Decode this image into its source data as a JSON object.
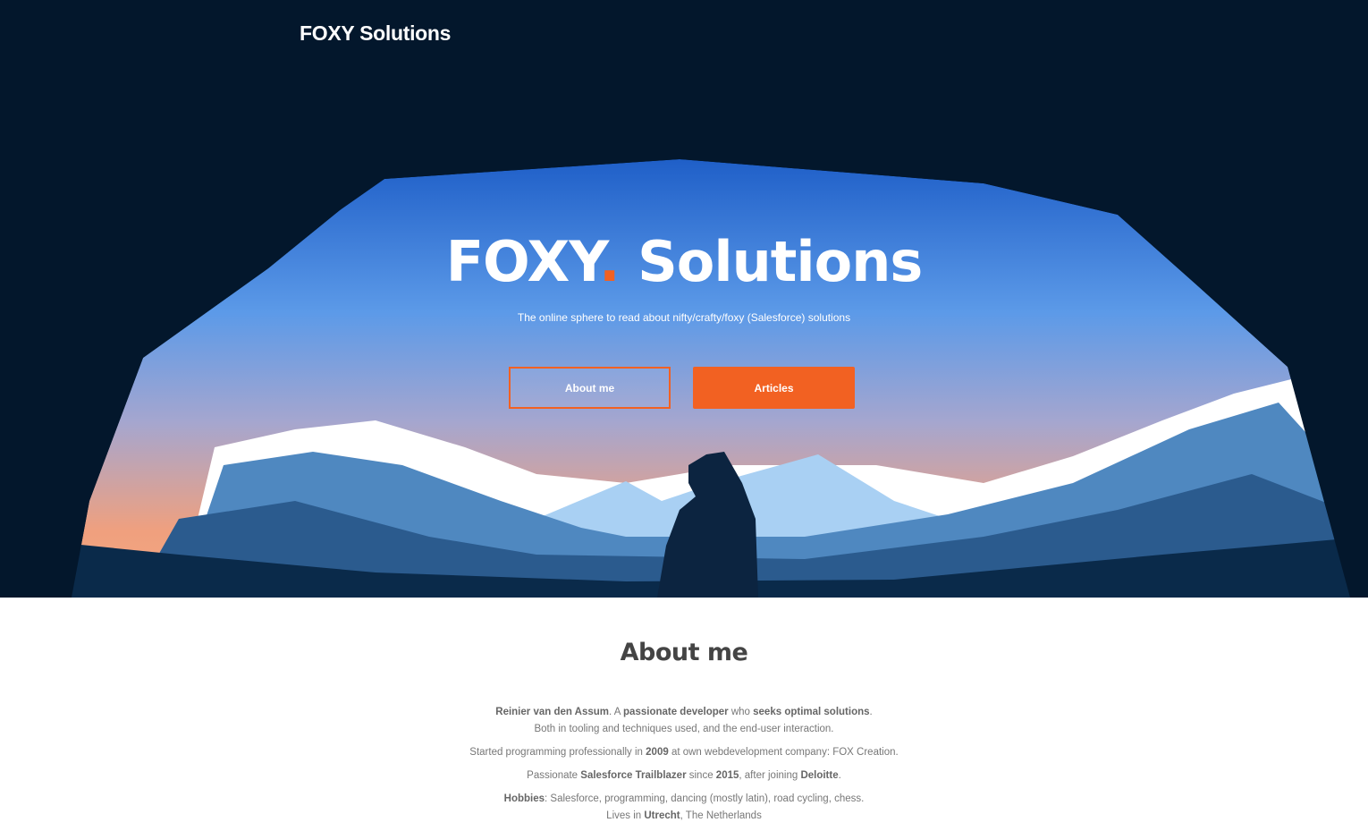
{
  "header": {
    "brand": "FOXY Solutions"
  },
  "hero": {
    "title_part1": "FOXY",
    "title_dot": ".",
    "title_part2": " Solutions",
    "tagline": "The online sphere to read about nifty/crafty/foxy (Salesforce) solutions",
    "buttons": {
      "about": "About me",
      "articles": "Articles"
    }
  },
  "about": {
    "heading": "About me",
    "paragraphs": [
      [
        [
          {
            "t": "Reinier van den Assum",
            "b": true
          },
          {
            "t": ". A "
          },
          {
            "t": "passionate developer",
            "b": true
          },
          {
            "t": " who "
          },
          {
            "t": "seeks optimal solutions",
            "b": true
          },
          {
            "t": "."
          }
        ],
        [
          {
            "t": "Both in tooling and techniques used, and the end-user interaction."
          }
        ]
      ],
      [
        [
          {
            "t": "Started programming professionally in "
          },
          {
            "t": "2009",
            "b": true
          },
          {
            "t": " at own webdevelopment company: FOX Creation."
          }
        ]
      ],
      [
        [
          {
            "t": "Passionate "
          },
          {
            "t": "Salesforce Trailblazer",
            "b": true
          },
          {
            "t": " since "
          },
          {
            "t": "2015",
            "b": true
          },
          {
            "t": ", after joining "
          },
          {
            "t": "Deloitte",
            "b": true
          },
          {
            "t": "."
          }
        ]
      ],
      [
        [
          {
            "t": "Hobbies",
            "b": true
          },
          {
            "t": ": Salesforce, programming, dancing (mostly latin), road cycling, chess."
          }
        ],
        [
          {
            "t": "Lives in "
          },
          {
            "t": "Utrecht",
            "b": true
          },
          {
            "t": ", The Netherlands"
          }
        ]
      ]
    ]
  },
  "colors": {
    "accent": "#f26122",
    "navy": "#03172c",
    "sky_top": "#3b7fe0",
    "sky_bottom": "#f2a07a"
  }
}
